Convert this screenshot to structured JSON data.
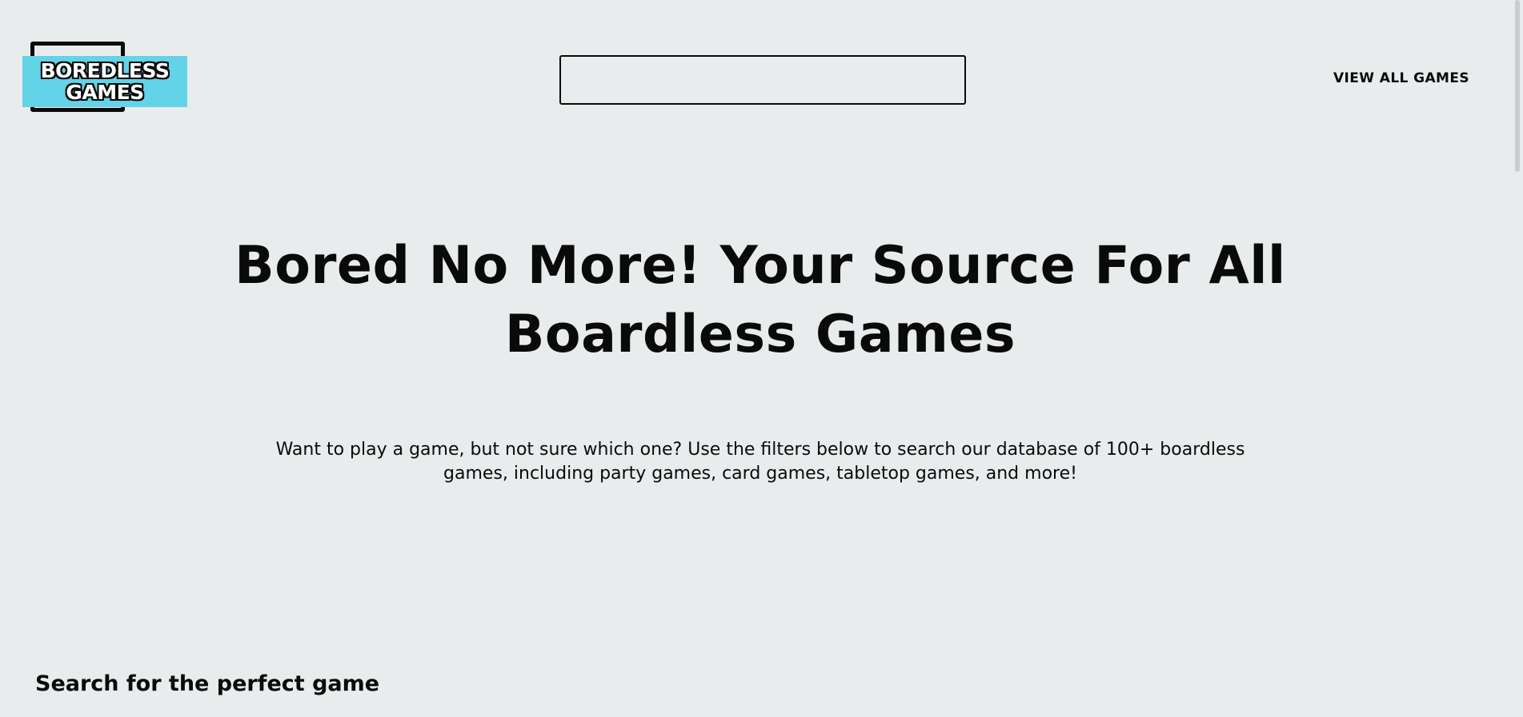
{
  "header": {
    "logo": {
      "line1": "BOREDLESS",
      "line2": "GAMES",
      "accent_color": "#63d3e8"
    },
    "search": {
      "value": "",
      "placeholder": ""
    },
    "nav": {
      "view_all_label": "VIEW ALL GAMES"
    }
  },
  "hero": {
    "title": "Bored No More! Your Source For All Boardless Games",
    "subtitle": "Want to play a game, but not sure which one? Use the filters below to search our database of 100+ boardless games, including party games, card games, tabletop games, and more!"
  },
  "search_section": {
    "heading": "Search for the perfect game"
  },
  "colors": {
    "background": "#e8eced",
    "text": "#0a0a0a",
    "accent": "#63d3e8"
  }
}
